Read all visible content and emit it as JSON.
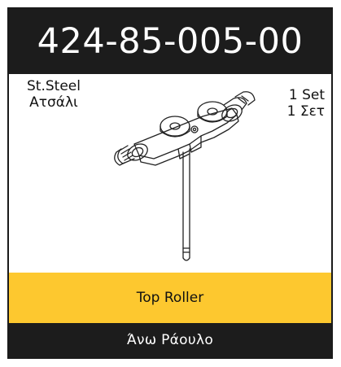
{
  "product": {
    "code": "424-85-005-00",
    "material_en": "St.Steel",
    "material_gr": "Ατσάλι",
    "qty_en": "1 Set",
    "qty_gr": "1 Σετ",
    "name_en": "Top Roller",
    "name_gr": "Άνω  Ράουλο",
    "illustration": "top-roller-drawing"
  },
  "colors": {
    "header_bg": "#1c1c1c",
    "accent": "#fdc82f",
    "text_light": "#ffffff",
    "text_dark": "#111111"
  }
}
